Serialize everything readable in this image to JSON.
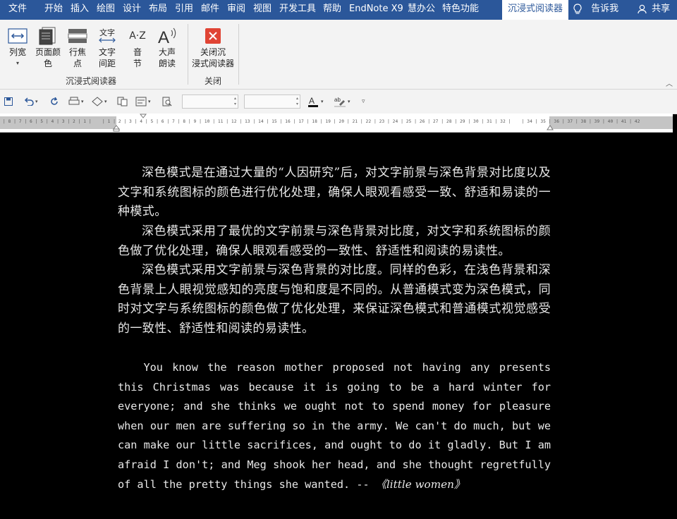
{
  "menu": {
    "tabs": [
      "文件",
      "开始",
      "插入",
      "绘图",
      "设计",
      "布局",
      "引用",
      "邮件",
      "审阅",
      "视图",
      "开发工具",
      "帮助",
      "EndNote X9",
      "慧办公",
      "特色功能"
    ],
    "active_tab": "沉浸式阅读器",
    "tell_me": "告诉我",
    "share": "共享"
  },
  "ribbon": {
    "group1": {
      "label": "沉浸式阅读器",
      "buttons": {
        "column_width": "列宽",
        "page_color": "页面颜\n色",
        "line_focus": "行焦\n点",
        "text_spacing": "文字\n间距",
        "syllables": "音\n节",
        "read_aloud": "大声\n朗读",
        "text_spacing_icon_text": "文字",
        "syllables_icon_text": "A·Z"
      }
    },
    "group2": {
      "label": "关闭",
      "buttons": {
        "close_reader": "关闭沉\n浸式阅读器"
      }
    }
  },
  "colors": {
    "accent": "#2b579a",
    "close_red": "#e04434",
    "doc_bg": "#000000",
    "doc_text": "#e8e8e8"
  },
  "ruler": {
    "text": "| 8 | 7 | 6 | 5 | 4 | 3 | 2 | 1 |    | 1 | 2 | 3 | 4 | 5 | 6 | 7 | 8 | 9 | 10 | 11 | 12 | 13 | 14 | 15 | 16 | 17 | 18 | 19 | 20 | 21 | 22 | 23 | 24 | 25 | 26 | 27 | 28 | 29 | 30 | 31 | 32 |    | 34 | 35 | 36 | 37 | 38 | 39 | 40 | 41 | 42"
  },
  "document": {
    "paragraphs_cn": [
      "深色模式是在通过大量的“人因研究”后，对文字前景与深色背景对比度以及文字和系统图标的颜色进行优化处理，确保人眼观看感受一致、舒适和易读的一种模式。",
      "深色模式采用了最优的文字前景与深色背景对比度，对文字和系统图标的颜色做了优化处理，确保人眼观看感受的一致性、舒适性和阅读的易读性。",
      "深色模式采用文字前景与深色背景的对比度。同样的色彩，在浅色背景和深色背景上人眼视觉感知的亮度与饱和度是不同的。从普通模式变为深色模式，同时对文字与系统图标的颜色做了优化处理，来保证深色模式和普通模式视觉感受的一致性、舒适性和阅读的易读性。"
    ],
    "paragraph_en": "You know the reason mother proposed not having any presents this Christmas was because it is going to be a hard winter for everyone; and she thinks we ought not to spend money for pleasure when our men are suffering so in the army. We can't do much, but we can make our little sacrifices, and ought to do it gladly. But I am afraid I don't; and Meg shook her head, and she thought regretfully of all the pretty things she wanted. --",
    "citation": "《little women》"
  }
}
